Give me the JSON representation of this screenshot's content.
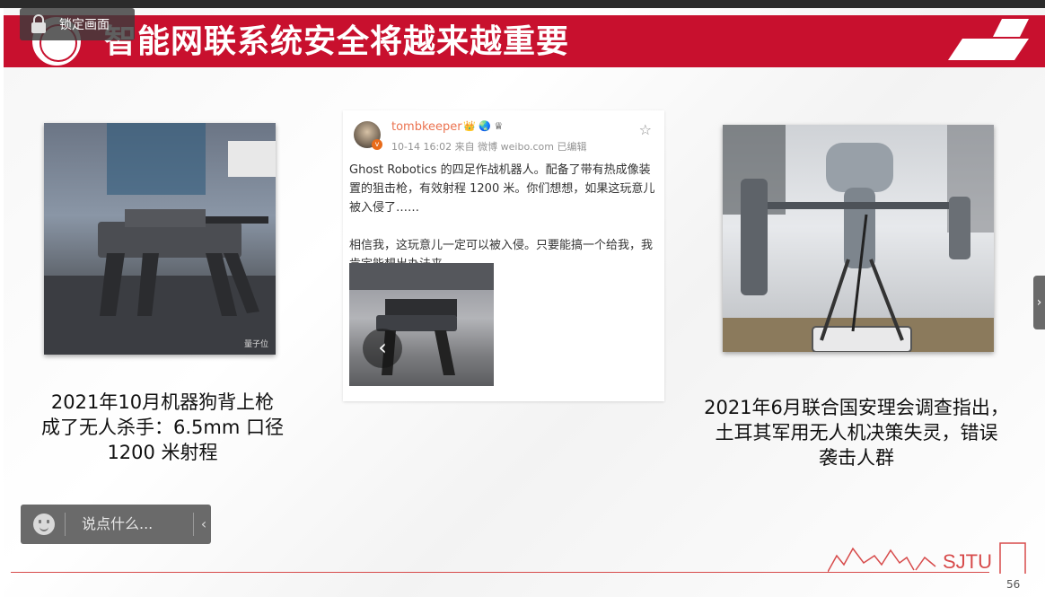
{
  "toolbar": {
    "lock_label": "锁定画面"
  },
  "slide": {
    "title": "智能网联系统安全将越来越重要",
    "page_number": "56",
    "footer_logo_text": "SJTU",
    "accent_color": "#c8102e",
    "left_caption": "2021年10月机器狗背上枪\n成了无人杀手：6.5mm 口径\n1200 米射程",
    "right_caption": "2021年6月联合国安理会调查指出，\n土耳其军用无人机决策失灵，错误\n袭击人群",
    "left_image_watermark": "量子位"
  },
  "weibo_post": {
    "username": "tombkeeper",
    "badges": "👑 🌏 ♕",
    "meta": "10-14 16:02  来自 微博 weibo.com  已编辑",
    "body": "Ghost Robotics 的四足作战机器人。配备了带有热成像装置的狙击枪，有效射程 1200 米。你们想想，如果这玩意儿被入侵了……\n\n相信我，这玩意儿一定可以被入侵。只要能搞一个给我，我肯定能想出办法来。",
    "verified": "v"
  },
  "comment_box": {
    "placeholder": "说点什么...",
    "collapse_glyph": "‹"
  },
  "side_tab": {
    "glyph": "›"
  },
  "image_icon_names": [
    "robot-dog-photo",
    "military-drone-photo",
    "weibo-robot-thumbnail"
  ]
}
